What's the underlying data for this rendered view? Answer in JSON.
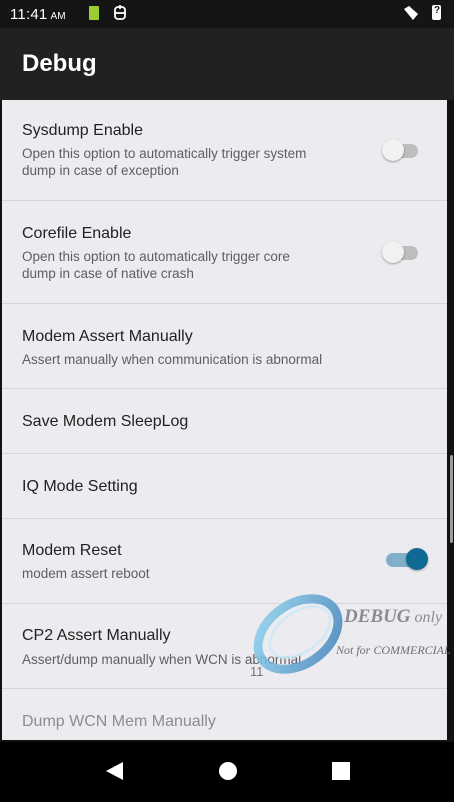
{
  "status_bar": {
    "time": "11:41",
    "ampm": "AM",
    "icons": [
      "sim-card-icon",
      "usb-debug-icon",
      "signal-icon",
      "battery-unknown-icon"
    ]
  },
  "app_bar": {
    "title": "Debug"
  },
  "settings": [
    {
      "title": "Sysdump Enable",
      "summary": "Open this option to automatically trigger system\ndump in case of exception",
      "switch": "off"
    },
    {
      "title": "Corefile Enable",
      "summary": "Open this option to automatically trigger core\ndump in case of native crash",
      "switch": "off"
    },
    {
      "title": "Modem Assert Manually",
      "summary": "Assert manually when communication is abnormal"
    },
    {
      "title": "Save Modem SleepLog"
    },
    {
      "title": "IQ Mode Setting"
    },
    {
      "title": "Modem Reset",
      "summary": "modem assert reboot",
      "switch": "on"
    },
    {
      "title": "CP2 Assert Manually",
      "summary": "Assert/dump manually when WCN is abnormal"
    },
    {
      "title": "Dump WCN Mem Manually"
    }
  ],
  "watermark": {
    "main": "DEBUG",
    "only": "only",
    "sub": "Not for COMMERCIAL",
    "page_number": "11"
  },
  "colors": {
    "accent": "#0f6a93",
    "appbar": "#212121",
    "background": "#ececf0"
  },
  "nav_bar": {
    "buttons": [
      "back-icon",
      "home-icon",
      "recents-icon"
    ]
  }
}
